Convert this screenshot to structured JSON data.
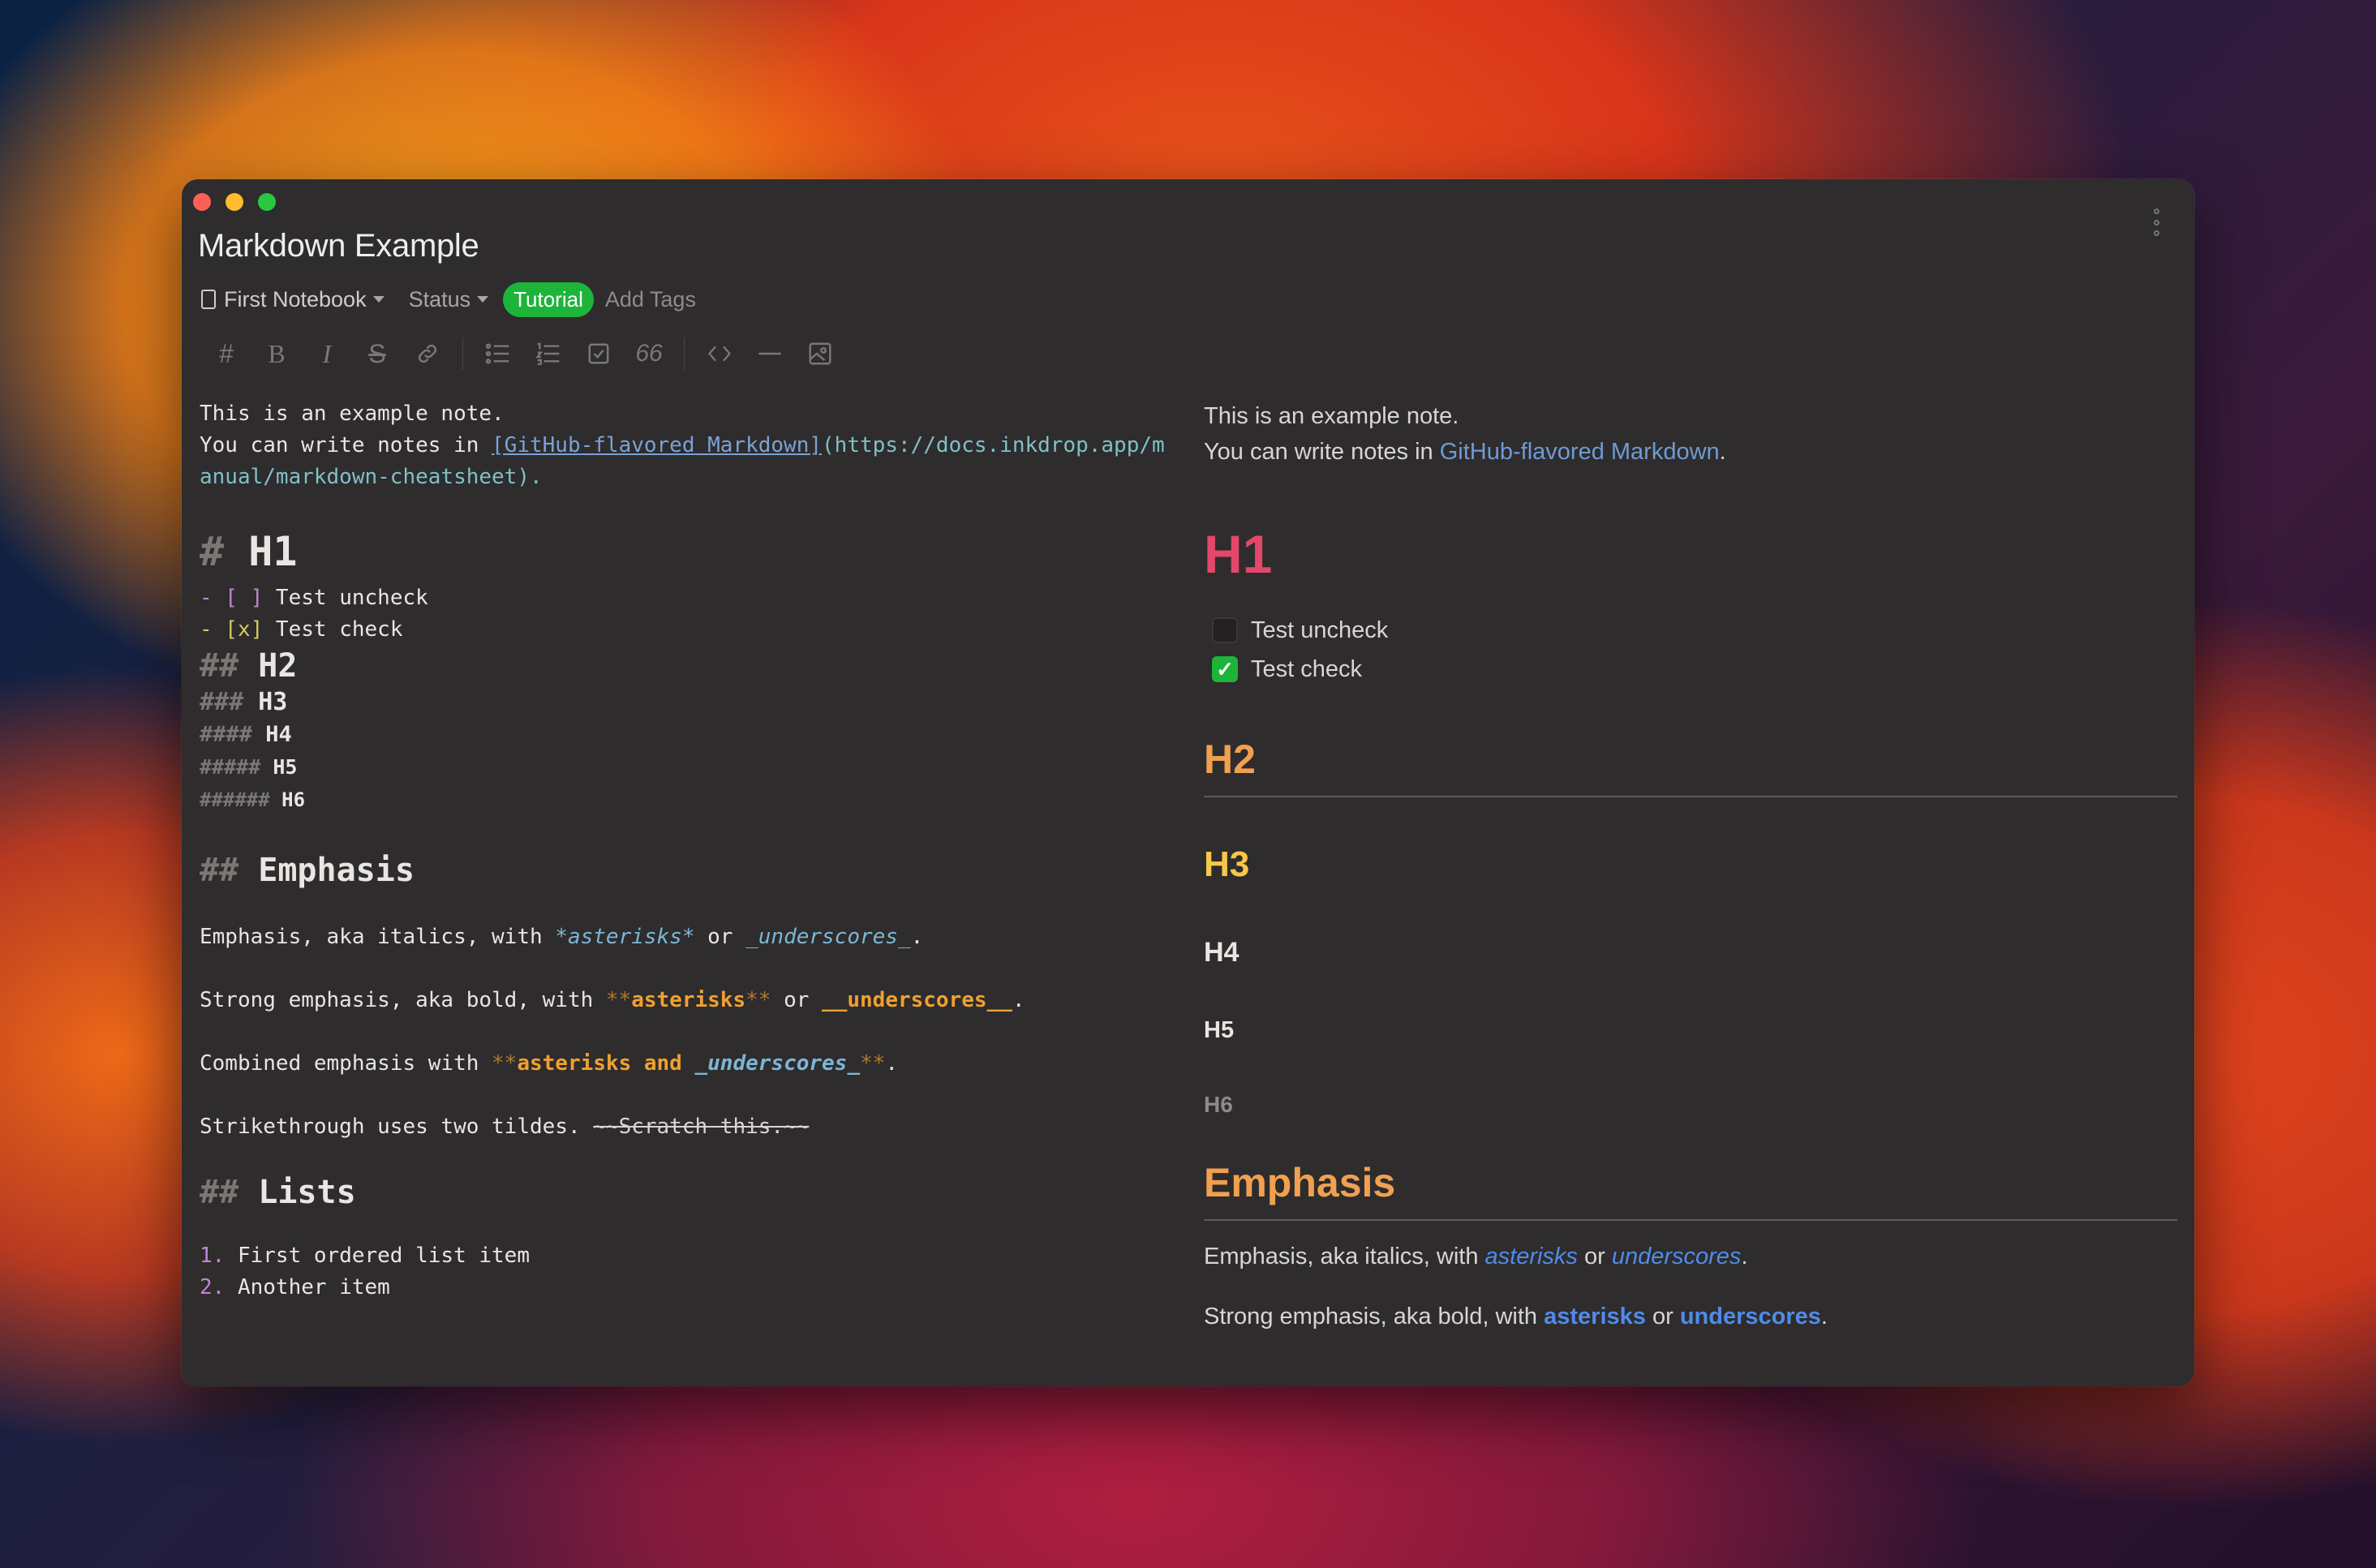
{
  "window": {
    "title": "Markdown Example",
    "notebook": "First Notebook",
    "status": "Status",
    "tag": "Tutorial",
    "add_tags": "Add Tags"
  },
  "toolbar": {
    "icons": [
      "heading-icon",
      "bold-icon",
      "italic-icon",
      "strikethrough-icon",
      "link-icon",
      "bulleted-list-icon",
      "numbered-list-icon",
      "task-list-icon",
      "blockquote-icon",
      "code-icon",
      "horizontal-rule-icon",
      "image-icon"
    ]
  },
  "editor": {
    "intro1": "This is an example note.",
    "intro2_prefix": "You can write notes in ",
    "intro2_link": "[GitHub-flavored Markdown]",
    "intro2_url1": "(https://docs.inkdrop.app/m",
    "intro2_url2": "anual/markdown-cheatsheet).",
    "h1_hash": "# ",
    "h1_text": "H1",
    "task1_mark": "- [ ]",
    "task1_text": " Test uncheck",
    "task2_mark": "- [x]",
    "task2_text": " Test check",
    "h2_hash": "## ",
    "h2_text": "H2",
    "h3_hash": "### ",
    "h3_text": "H3",
    "h4_hash": "#### ",
    "h4_text": "H4",
    "h5_hash": "##### ",
    "h5_text": "H5",
    "h6_hash": "###### ",
    "h6_text": "H6",
    "emphasis_hash": "## ",
    "emphasis_text": "Emphasis",
    "em_line_prefix": "Emphasis, aka italics, with ",
    "em_asterisks": "*asterisks*",
    "em_or": " or ",
    "em_underscores": "_underscores_",
    "em_end": ".",
    "strong_prefix": "Strong emphasis, aka bold, with ",
    "strong_mark1": "**",
    "strong_asterisks": "asterisks",
    "strong_mark2": "**",
    "strong_or": " or ",
    "strong_underscores": "__underscores__",
    "strong_end": ".",
    "combined_prefix": "Combined emphasis with ",
    "combined_mark1": "**",
    "combined_bold": "asterisks and ",
    "combined_italic": "_underscores_",
    "combined_mark2": "**",
    "combined_end": ".",
    "strike_prefix": "Strikethrough uses two tildes. ",
    "strike_text": "~~Scratch this.~~",
    "lists_hash": "## ",
    "lists_text": "Lists",
    "ol1_mark": "1.",
    "ol1_text": " First ordered list item",
    "ol2_mark": "2.",
    "ol2_text": " Another item"
  },
  "preview": {
    "intro1": "This is an example note.",
    "intro2_prefix": "You can write notes in ",
    "intro2_link": "GitHub-flavored Markdown",
    "intro2_end": ".",
    "h1": "H1",
    "task1": "Test uncheck",
    "task1_checked": false,
    "task2": "Test check",
    "task2_checked": true,
    "h2": "H2",
    "h3": "H3",
    "h4": "H4",
    "h5": "H5",
    "h6": "H6",
    "emphasis": "Emphasis",
    "em_prefix": "Emphasis, aka italics, with ",
    "em_asterisks": "asterisks",
    "em_or": " or ",
    "em_underscores": "underscores",
    "em_end": ".",
    "strong_prefix": "Strong emphasis, aka bold, with ",
    "strong_asterisks": "asterisks",
    "strong_or": " or ",
    "strong_underscores": "underscores",
    "strong_end": "."
  },
  "colors": {
    "tag_green": "#1db43a",
    "h1_pink": "#e4476a",
    "h2_orange": "#f0a050",
    "h3_yellow": "#f7c848",
    "link_blue": "#6f9bd4"
  }
}
